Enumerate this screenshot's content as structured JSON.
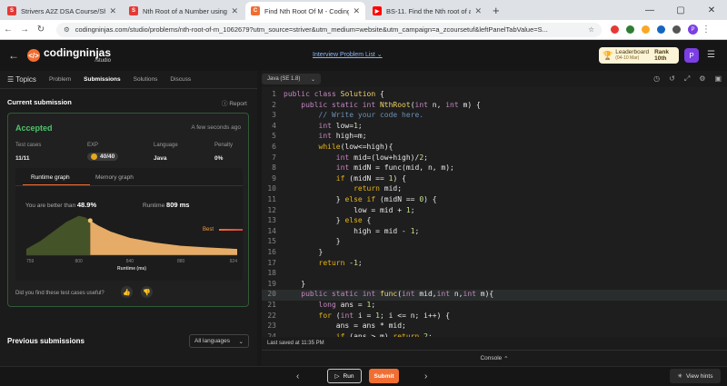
{
  "browser": {
    "tabs": [
      {
        "title": "Strivers A2Z DSA Course/Sheet",
        "color": "#e53935",
        "glyph": "S"
      },
      {
        "title": "Nth Root of a Number using Bi",
        "color": "#e53935",
        "glyph": "S"
      },
      {
        "title": "Find Nth Root Of M - Coding N",
        "color": "#f16e32",
        "glyph": "C"
      },
      {
        "title": "BS-11. Find the Nth root of an",
        "color": "#ff0000",
        "glyph": "▶"
      }
    ],
    "url": "codingninjas.com/studio/problems/nth-root-of-m_1062679?utm_source=striver&utm_medium=website&utm_campaign=a_zcoursetuf&leftPanelTabValue=S...",
    "profile": "P"
  },
  "header": {
    "logo_name": "codingninjas",
    "logo_sub": "/studio",
    "interview_list": "Interview Problem List",
    "leaderboard": "Leaderboard",
    "leaderboard_range": "(04-10 Mar)",
    "rank": "Rank 10th",
    "avatar": "P"
  },
  "left": {
    "tabs": [
      "Topics",
      "Problem",
      "Submissions",
      "Solutions",
      "Discuss"
    ],
    "current_submission": "Current submission",
    "report": "Report",
    "status": "Accepted",
    "time_ago": "A few seconds ago",
    "stats": [
      {
        "label": "Test cases",
        "value": "11/11"
      },
      {
        "label": "EXP",
        "value": "40/40"
      },
      {
        "label": "Language",
        "value": "Java"
      },
      {
        "label": "Penalty",
        "value": "0%"
      }
    ],
    "graph_tabs": [
      "Runtime graph",
      "Memory graph"
    ],
    "better_than_label": "You are better than",
    "better_than_value": "48.9%",
    "runtime_label": "Runtime",
    "runtime_value": "809 ms",
    "best_label": "Best",
    "useful_q": "Did you find these test cases useful?",
    "previous_submissions": "Previous submissions",
    "language_filter": "All languages"
  },
  "chart_data": {
    "type": "area",
    "xlabel": "Runtime (ms)",
    "x_ticks": [
      759,
      800,
      840,
      880,
      924
    ],
    "x": [
      759,
      770,
      780,
      790,
      800,
      805,
      809,
      815,
      825,
      840,
      860,
      880,
      900,
      924
    ],
    "values": [
      8,
      18,
      30,
      42,
      50,
      48,
      44,
      38,
      30,
      22,
      16,
      12,
      10,
      8
    ],
    "user_runtime": 809,
    "xlim": [
      759,
      924
    ],
    "ylim": [
      0,
      60
    ],
    "colors": {
      "fill_before": "#4a5a2a",
      "fill_after": "#f0b36b",
      "marker": "#f3c26b"
    }
  },
  "editor": {
    "language": "Java (SE 1.8)",
    "last_saved": "Last saved at 11:35 PM",
    "console": "Console"
  },
  "code": [
    [
      [
        "kt",
        "public "
      ],
      [
        "kt",
        "class "
      ],
      [
        "ty",
        "Solution "
      ],
      [
        "tx",
        "{"
      ]
    ],
    [
      [
        "tx",
        "    "
      ],
      [
        "kt",
        "public "
      ],
      [
        "kt",
        "static "
      ],
      [
        "kt",
        "int "
      ],
      [
        "fn",
        "NthRoot"
      ],
      [
        "tx",
        "("
      ],
      [
        "kt",
        "int "
      ],
      [
        "tx",
        "n, "
      ],
      [
        "kt",
        "int "
      ],
      [
        "tx",
        "m) {"
      ]
    ],
    [
      [
        "cm",
        "        // Write your code here."
      ]
    ],
    [
      [
        "tx",
        "        "
      ],
      [
        "kt",
        "int "
      ],
      [
        "tx",
        "low="
      ],
      [
        "nm",
        "1"
      ],
      [
        "tx",
        ";"
      ]
    ],
    [
      [
        "tx",
        "        "
      ],
      [
        "kt",
        "int "
      ],
      [
        "tx",
        "high=m;"
      ]
    ],
    [
      [
        "tx",
        "        "
      ],
      [
        "kw",
        "while"
      ],
      [
        "tx",
        "(low<=high){"
      ]
    ],
    [
      [
        "tx",
        "            "
      ],
      [
        "kt",
        "int "
      ],
      [
        "tx",
        "mid=(low+high)/"
      ],
      [
        "nm",
        "2"
      ],
      [
        "tx",
        ";"
      ]
    ],
    [
      [
        "tx",
        "            "
      ],
      [
        "kt",
        "int "
      ],
      [
        "tx",
        "midN = func(mid, n, m);"
      ]
    ],
    [
      [
        "tx",
        "            "
      ],
      [
        "kw",
        "if "
      ],
      [
        "tx",
        "(midN == "
      ],
      [
        "nm",
        "1"
      ],
      [
        "tx",
        ") {"
      ]
    ],
    [
      [
        "tx",
        "                "
      ],
      [
        "kw",
        "return "
      ],
      [
        "tx",
        "mid;"
      ]
    ],
    [
      [
        "tx",
        "            } "
      ],
      [
        "kw",
        "else if "
      ],
      [
        "tx",
        "(midN == "
      ],
      [
        "nm",
        "0"
      ],
      [
        "tx",
        ") {"
      ]
    ],
    [
      [
        "tx",
        "                low = mid + "
      ],
      [
        "nm",
        "1"
      ],
      [
        "tx",
        ";"
      ]
    ],
    [
      [
        "tx",
        "            } "
      ],
      [
        "kw",
        "else "
      ],
      [
        "tx",
        "{"
      ]
    ],
    [
      [
        "tx",
        "                high = mid - "
      ],
      [
        "nm",
        "1"
      ],
      [
        "tx",
        ";"
      ]
    ],
    [
      [
        "tx",
        "            }"
      ]
    ],
    [
      [
        "tx",
        "        }"
      ]
    ],
    [
      [
        "tx",
        "        "
      ],
      [
        "kw",
        "return "
      ],
      [
        "tx",
        "-"
      ],
      [
        "nm",
        "1"
      ],
      [
        "tx",
        ";"
      ]
    ],
    [
      [
        "tx",
        ""
      ]
    ],
    [
      [
        "tx",
        "    }"
      ]
    ],
    [
      [
        "tx",
        "    "
      ],
      [
        "kt",
        "public "
      ],
      [
        "kt",
        "static "
      ],
      [
        "kt",
        "int "
      ],
      [
        "fn",
        "func"
      ],
      [
        "tx",
        "("
      ],
      [
        "kt",
        "int "
      ],
      [
        "tx",
        "mid,"
      ],
      [
        "kt",
        "int "
      ],
      [
        "tx",
        "n,"
      ],
      [
        "kt",
        "int "
      ],
      [
        "tx",
        "m){"
      ]
    ],
    [
      [
        "tx",
        "        "
      ],
      [
        "kt",
        "long "
      ],
      [
        "tx",
        "ans = "
      ],
      [
        "nm",
        "1"
      ],
      [
        "tx",
        ";"
      ]
    ],
    [
      [
        "tx",
        "        "
      ],
      [
        "kw",
        "for "
      ],
      [
        "tx",
        "("
      ],
      [
        "kt",
        "int "
      ],
      [
        "tx",
        "i = "
      ],
      [
        "nm",
        "1"
      ],
      [
        "tx",
        "; i <= n; i++) {"
      ]
    ],
    [
      [
        "tx",
        "            ans = ans * mid;"
      ]
    ],
    [
      [
        "tx",
        "            "
      ],
      [
        "kw",
        "if "
      ],
      [
        "tx",
        "(ans > m) "
      ],
      [
        "kw",
        "return "
      ],
      [
        "nm",
        "2"
      ],
      [
        "tx",
        ";"
      ]
    ]
  ],
  "bottom": {
    "run": "Run",
    "submit": "Submit",
    "view_hints": "View hints"
  }
}
